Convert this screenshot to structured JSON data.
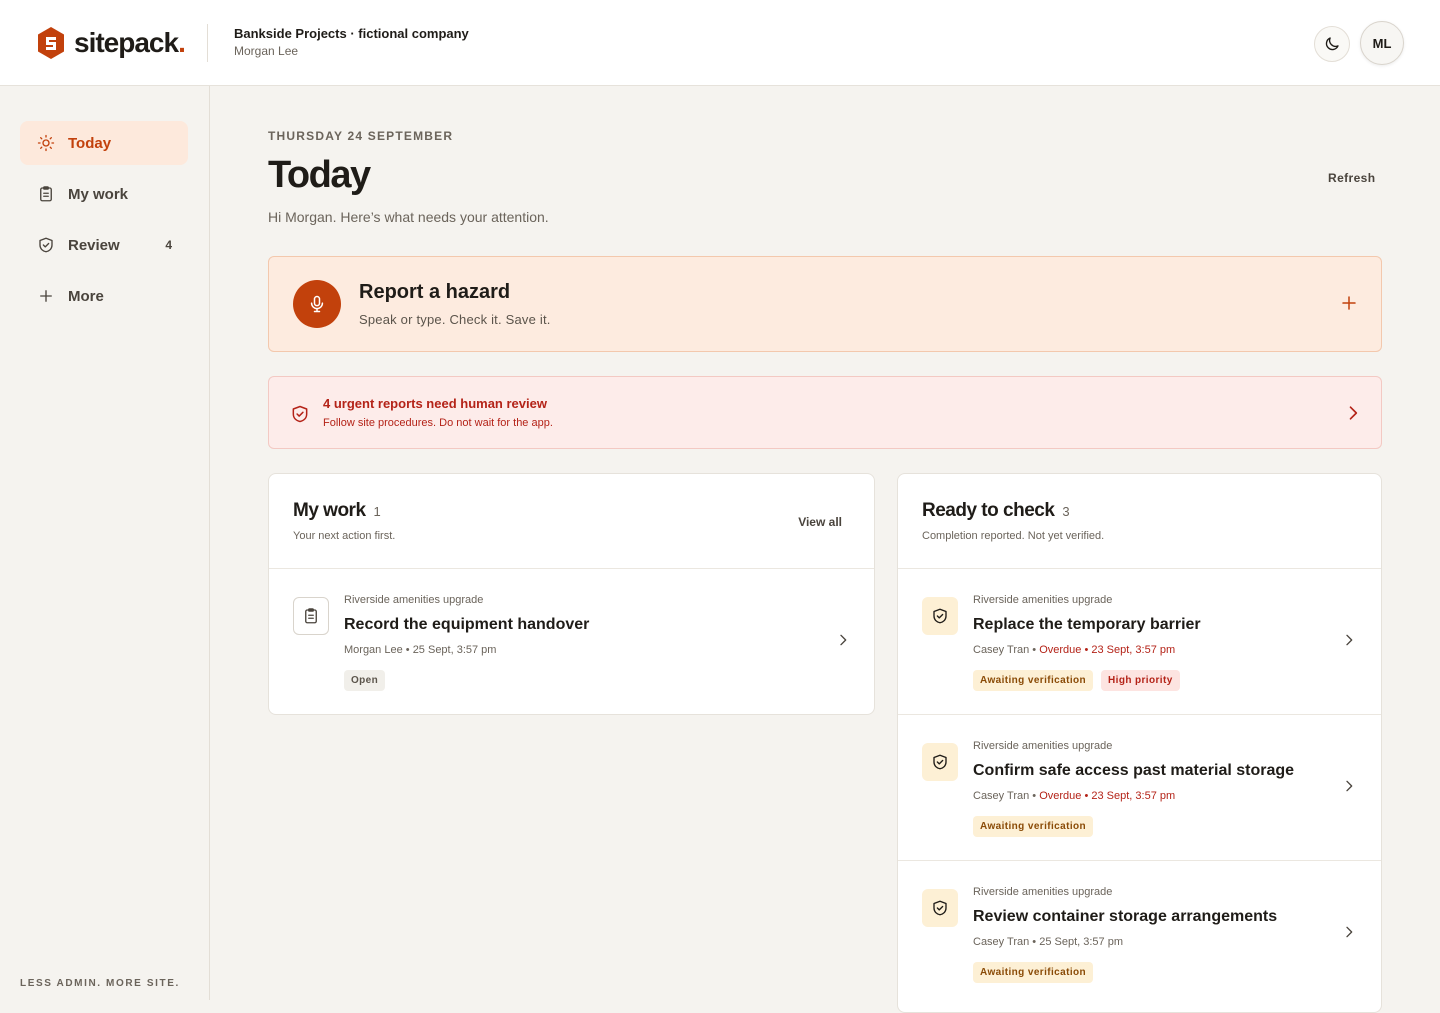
{
  "header": {
    "logo_text": "sitepack",
    "logo_dot": ".",
    "org_name": "Bankside Projects · fictional company",
    "user_name": "Morgan Lee",
    "theme_icon": "moon-icon",
    "avatar_initials": "ML"
  },
  "sidebar": {
    "items": [
      {
        "label": "Today",
        "icon": "sun-icon",
        "active": true
      },
      {
        "label": "My work",
        "icon": "clipboard-icon"
      },
      {
        "label": "Review",
        "icon": "shield-check-icon",
        "count": "4"
      },
      {
        "label": "More",
        "icon": "plus-icon"
      }
    ],
    "tagline": "LESS ADMIN. MORE SITE."
  },
  "main": {
    "date": "THURSDAY 24 SEPTEMBER",
    "title": "Today",
    "greeting": "Hi Morgan. Here’s what needs your attention.",
    "refresh_label": "Refresh",
    "hazard": {
      "title": "Report a hazard",
      "subtitle": "Speak or type. Check it. Save it."
    },
    "alert": {
      "title": "4 urgent reports need human review",
      "subtitle": "Follow site procedures. Do not wait for the app."
    },
    "my_work": {
      "title": "My work",
      "count": "1",
      "subtitle": "Your next action first.",
      "view_all": "View all",
      "items": [
        {
          "project": "Riverside amenities upgrade",
          "title": "Record the equipment handover",
          "person": "Morgan Lee",
          "sep": " • ",
          "date": "25 Sept, 3:57 pm",
          "tag": "Open"
        }
      ]
    },
    "ready_to_check": {
      "title": "Ready to check",
      "count": "3",
      "subtitle": "Completion reported. Not yet verified.",
      "items": [
        {
          "project": "Riverside amenities upgrade",
          "title": "Replace the temporary barrier",
          "person": "Casey Tran",
          "sep1": " • ",
          "overdue": "Overdue • 23 Sept, 3:57 pm",
          "tag1": "Awaiting verification",
          "tag2": "High priority"
        },
        {
          "project": "Riverside amenities upgrade",
          "title": "Confirm safe access past material storage",
          "person": "Casey Tran",
          "sep1": " • ",
          "overdue": "Overdue • 23 Sept, 3:57 pm",
          "tag1": "Awaiting verification"
        },
        {
          "project": "Riverside amenities upgrade",
          "title": "Review container storage arrangements",
          "person": "Casey Tran",
          "sep1": " • ",
          "date": "25 Sept, 3:57 pm",
          "tag1": "Awaiting verification"
        }
      ]
    }
  },
  "colors": {
    "accent": "#c2410c",
    "danger": "#b42318",
    "background": "#f5f3ef"
  }
}
